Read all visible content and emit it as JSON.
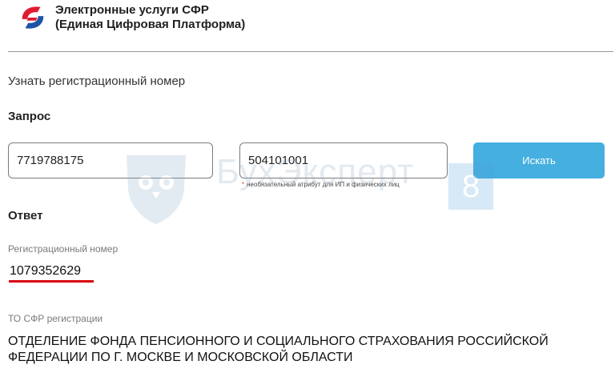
{
  "header": {
    "brand_line1": "Электронные услуги СФР",
    "brand_line2": "(Единая Цифровая Платформа)",
    "logo_icon": "sfr-logo-icon"
  },
  "page": {
    "title": "Узнать регистрационный номер"
  },
  "request": {
    "title": "Запрос",
    "inn_value": "7719788175",
    "kpp_value": "504101001",
    "hint_star": "*",
    "hint_text": "необязательный атрибут для ИП и физических лиц",
    "search_label": "Искать"
  },
  "response": {
    "title": "Ответ",
    "reg_label": "Регистрационный номер",
    "reg_value": "1079352629",
    "to_label": "ТО СФР регистрации",
    "to_value": "ОТДЕЛЕНИЕ ФОНДА ПЕНСИОННОГО И СОЦИАЛЬНОГО СТРАХОВАНИЯ РОССИЙСКОЙ ФЕДЕРАЦИИ ПО Г. МОСКВЕ И МОСКОВСКОЙ ОБЛАСТИ"
  },
  "watermark": {
    "text": "БухЭксперт",
    "badge": "8"
  },
  "colors": {
    "accent": "#45afe0",
    "logo_red": "#e01b2f",
    "logo_blue": "#1e54a6",
    "underline": "#d9000f"
  }
}
